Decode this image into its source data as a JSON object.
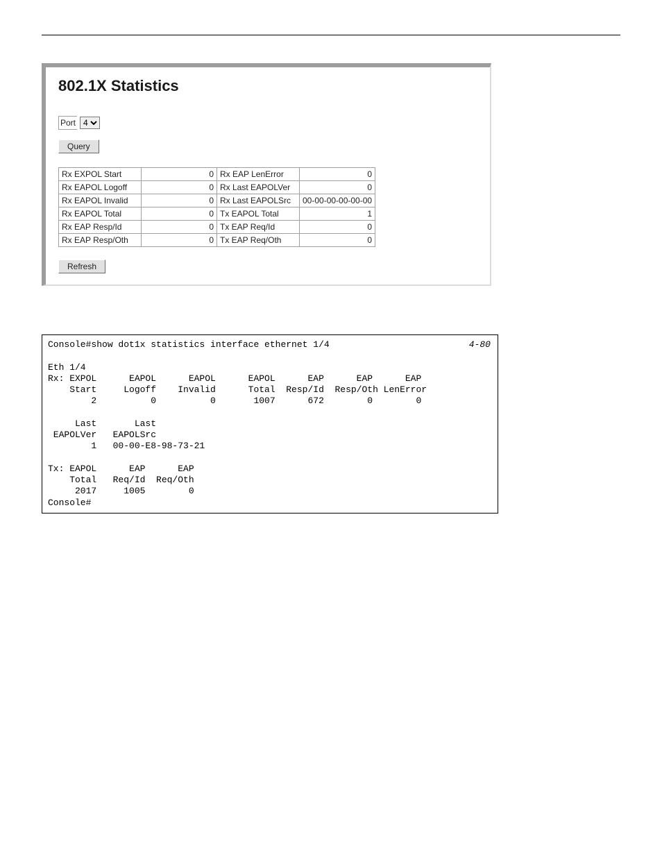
{
  "panel": {
    "title": "802.1X Statistics",
    "port_label": "Port",
    "port_value": "4",
    "query_button": "Query",
    "refresh_button": "Refresh",
    "rows": [
      {
        "l1": "Rx EXPOL Start",
        "v1": "0",
        "l2": "Rx EAP LenError",
        "v2": "0"
      },
      {
        "l1": "Rx EAPOL Logoff",
        "v1": "0",
        "l2": "Rx Last EAPOLVer",
        "v2": "0"
      },
      {
        "l1": "Rx EAPOL Invalid",
        "v1": "0",
        "l2": "Rx Last EAPOLSrc",
        "v2": "00-00-00-00-00-00"
      },
      {
        "l1": "Rx EAPOL Total",
        "v1": "0",
        "l2": "Tx EAPOL Total",
        "v2": "1"
      },
      {
        "l1": "Rx EAP Resp/Id",
        "v1": "0",
        "l2": "Tx EAP Req/Id",
        "v2": "0"
      },
      {
        "l1": "Rx EAP Resp/Oth",
        "v1": "0",
        "l2": "Tx EAP Req/Oth",
        "v2": "0"
      }
    ]
  },
  "cli": {
    "ref": "4-80",
    "text": "Console#show dot1x statistics interface ethernet 1/4\n\nEth 1/4\nRx: EXPOL      EAPOL      EAPOL      EAPOL      EAP      EAP      EAP\n    Start     Logoff    Invalid      Total  Resp/Id  Resp/Oth LenError\n        2          0          0       1007      672        0        0\n\n     Last       Last\n EAPOLVer   EAPOLSrc\n        1   00-00-E8-98-73-21\n\nTx: EAPOL      EAP      EAP\n    Total   Req/Id  Req/Oth\n     2017     1005        0\nConsole#"
  }
}
